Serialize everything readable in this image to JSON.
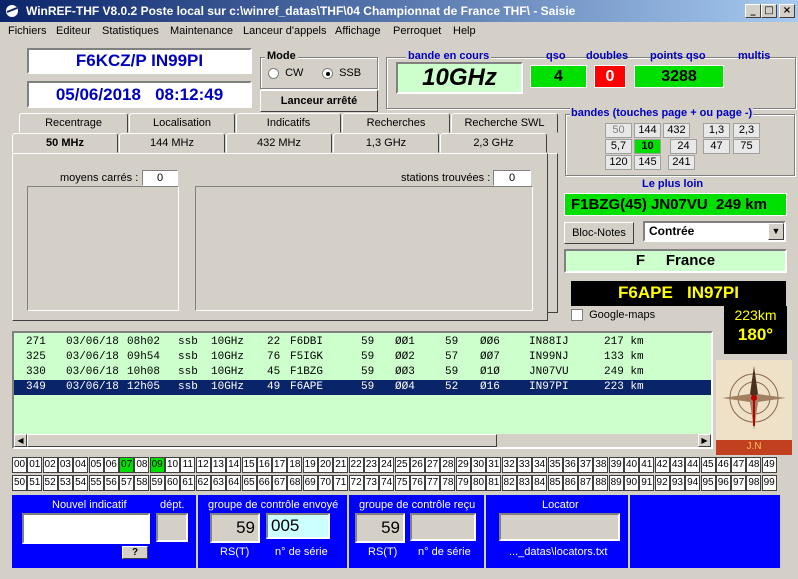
{
  "window": {
    "title": "WinREF-THF V8.0.2 Poste local sur c:\\winref_datas\\THF\\04 Championnat de France THF\\ -   Saisie",
    "min": "_",
    "max": "□",
    "close": "×"
  },
  "menu": [
    "Fichiers",
    "Editeur",
    "Statistiques",
    "Maintenance",
    "Lanceur d'appels",
    "Affichage",
    "Perroquet",
    "Help"
  ],
  "station": {
    "callsign": "F6KCZ/P  IN99PI",
    "datetime": "05/06/2018   08:12:49"
  },
  "mode": {
    "label": "Mode",
    "cw": "CW",
    "ssb": "SSB",
    "selected": "SSB"
  },
  "launcher_button": "Lanceur arrêté",
  "band_current": {
    "label": "bande en cours",
    "value": "10GHz"
  },
  "counters": {
    "qso_label": "qso",
    "qso": "4",
    "doubles_label": "doubles",
    "doubles": "0",
    "points_label": "points qso",
    "points": "3288",
    "multis_label": "multis"
  },
  "bands": {
    "label": "bandes (touches page + ou page -)",
    "cells": [
      "50",
      "144",
      "432",
      "1,3",
      "2,3",
      "5,7",
      "10",
      "24",
      "47",
      "75",
      "120",
      "145",
      "241"
    ],
    "active": "10"
  },
  "tabs_top": [
    "Recentrage",
    "Localisation",
    "Indicatifs",
    "Recherches",
    "Recherche SWL"
  ],
  "tabs_bottom": [
    "50 MHz",
    "144 MHz",
    "432 MHz",
    "1,3 GHz",
    "2,3 GHz"
  ],
  "tab_panel": {
    "squares_label": "moyens carrés :",
    "squares_count": "0",
    "stations_label": "stations trouvées :",
    "stations_count": "0"
  },
  "farthest": {
    "label": "Le plus loin",
    "value": "F1BZG(45) JN07VU  249 km"
  },
  "notes": {
    "button": "Bloc-Notes",
    "select": "Contrée",
    "country": "F     France"
  },
  "last": {
    "callsign": "F6APE   IN97PI",
    "distance": "223km",
    "bearing": "180°",
    "google": "Google-maps",
    "compass_label": "J.N"
  },
  "log": [
    {
      "n": "271",
      "date": "03/06/18",
      "time": "08h02",
      "mode": "ssb",
      "band": "10GHz",
      "dept": "22",
      "call": "F6DBI",
      "rs": "59",
      "sent": "ØØ1",
      "rr": "59",
      "rcvd": "ØØ6",
      "loc": "IN88IJ",
      "km": "217 km"
    },
    {
      "n": "325",
      "date": "03/06/18",
      "time": "09h54",
      "mode": "ssb",
      "band": "10GHz",
      "dept": "76",
      "call": "F5IGK",
      "rs": "59",
      "sent": "ØØ2",
      "rr": "57",
      "rcvd": "ØØ7",
      "loc": "IN99NJ",
      "km": "133 km"
    },
    {
      "n": "330",
      "date": "03/06/18",
      "time": "10h08",
      "mode": "ssb",
      "band": "10GHz",
      "dept": "45",
      "call": "F1BZG",
      "rs": "59",
      "sent": "ØØ3",
      "rr": "59",
      "rcvd": "Ø1Ø",
      "loc": "JN07VU",
      "km": "249 km"
    },
    {
      "n": "349",
      "date": "03/06/18",
      "time": "12h05",
      "mode": "ssb",
      "band": "10GHz",
      "dept": "49",
      "call": "F6APE",
      "rs": "59",
      "sent": "ØØ4",
      "rr": "52",
      "rcvd": "Ø16",
      "loc": "IN97PI",
      "km": "223 km"
    }
  ],
  "selected_row": 3,
  "dept_grid": {
    "green": [
      "07",
      "09"
    ]
  },
  "bottom": {
    "new_call": "Nouvel indicatif",
    "dept": "dépt.",
    "help": "?",
    "sent_group": "groupe de contrôle envoyé",
    "sent_rs": "59",
    "sent_serial": "005",
    "rs_label": "RS(T)",
    "serial_label": "n° de série",
    "rcvd_group": "groupe de contrôle reçu",
    "rcvd_rs": "59",
    "locator_label": "Locator",
    "locator_file": "..._datas\\locators.txt"
  },
  "colors": {
    "green": "#00e000",
    "red": "#ff0000",
    "blue": "#0000ff",
    "navy": "#0a246a",
    "lightgreen": "#ccffcc"
  }
}
